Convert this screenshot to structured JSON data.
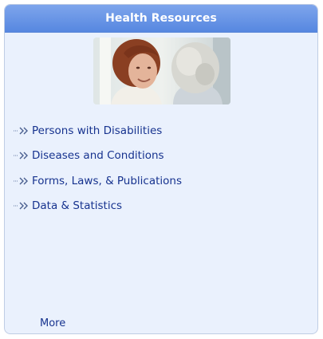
{
  "header": {
    "title": "Health Resources"
  },
  "photo": {
    "icon": "health-resources-photo",
    "accent": "#5687e0"
  },
  "links": [
    {
      "label": "Persons with Disabilities",
      "icon": "double-arrow-icon"
    },
    {
      "label": "Diseases and Conditions",
      "icon": "double-arrow-icon"
    },
    {
      "label": "Forms, Laws, & Publications",
      "icon": "double-arrow-icon"
    },
    {
      "label": "Data & Statistics",
      "icon": "double-arrow-icon"
    }
  ],
  "footer": {
    "more_label": "More"
  },
  "colors": {
    "header": "#5687e0",
    "panel_bg": "#eaf1fd",
    "link": "#17338f"
  }
}
